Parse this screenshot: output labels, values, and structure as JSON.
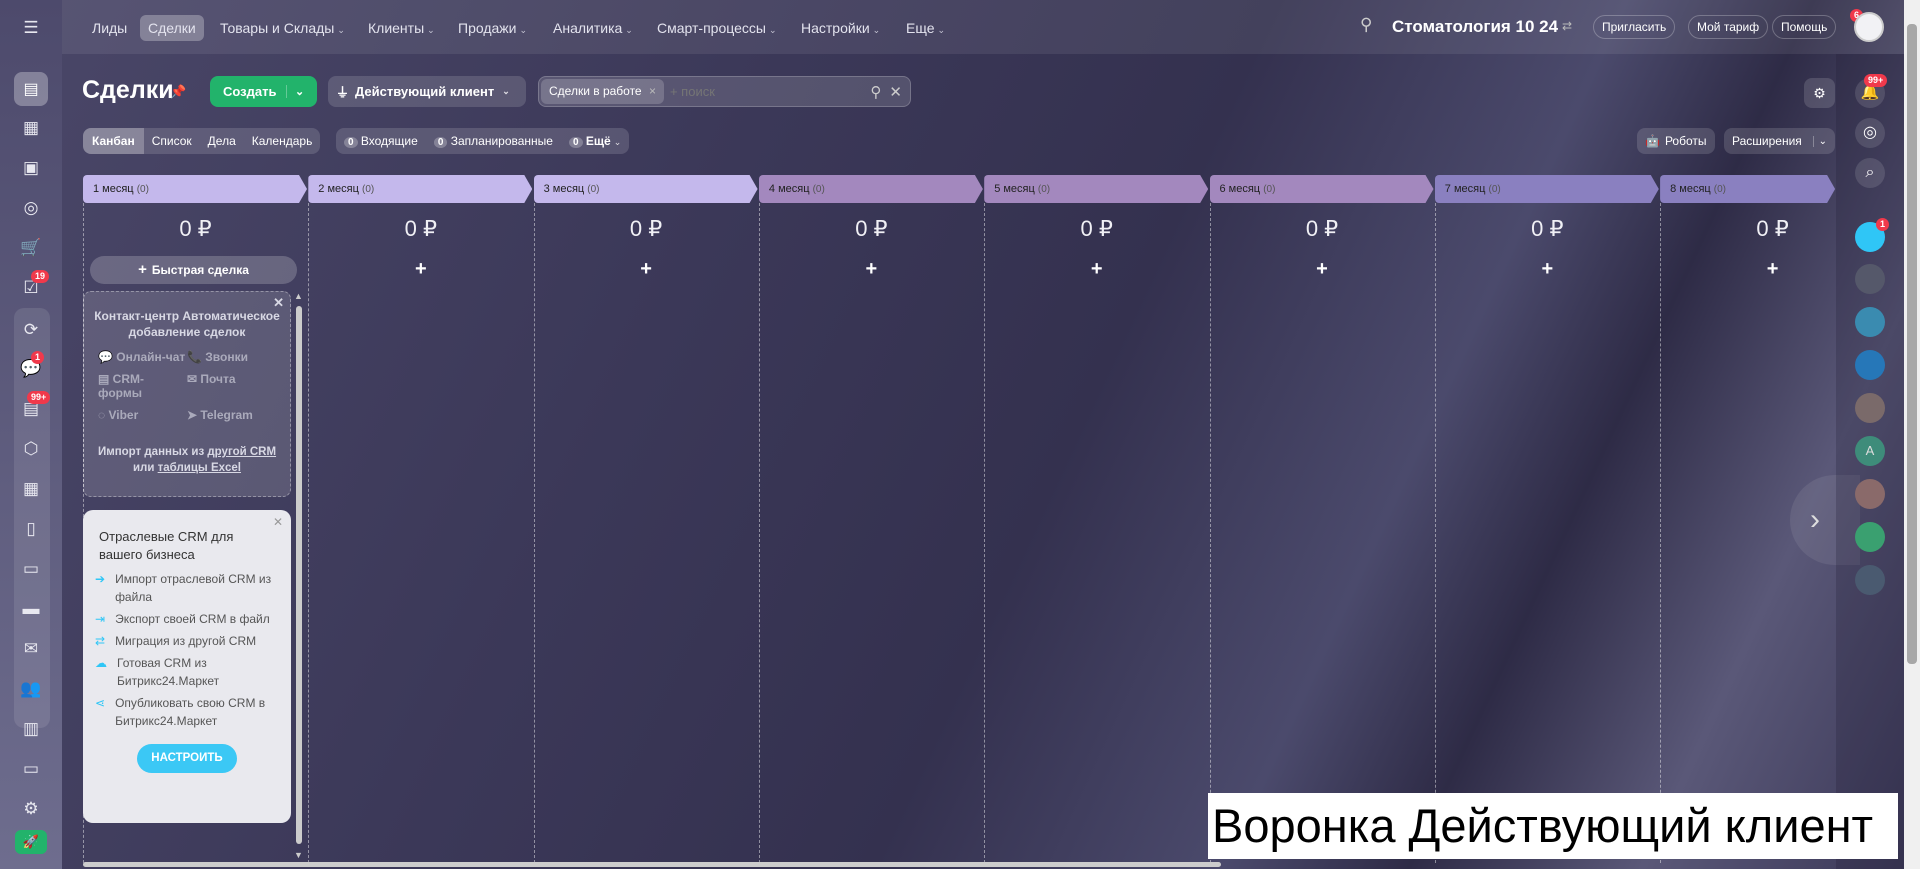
{
  "topnav": {
    "items": [
      {
        "label": "Лиды"
      },
      {
        "label": "Сделки",
        "active": true
      },
      {
        "label": "Товары и Склады",
        "dropdown": true
      },
      {
        "label": "Клиенты",
        "dropdown": true
      },
      {
        "label": "Продажи",
        "dropdown": true
      },
      {
        "label": "Аналитика",
        "dropdown": true
      },
      {
        "label": "Смарт-процессы",
        "dropdown": true
      },
      {
        "label": "Настройки",
        "dropdown": true
      },
      {
        "label": "Еще",
        "dropdown": true
      }
    ],
    "company": "Стоматология 10 24",
    "invite": "Пригласить",
    "tariff": "Мой тариф",
    "help": "Помощь",
    "help_badge": "6"
  },
  "leftbar": {
    "badges": {
      "tasks": "19",
      "chats": "1",
      "feed": "99+"
    }
  },
  "header": {
    "title": "Сделки",
    "create": "Создать",
    "funnel": "Действующий клиент",
    "filter_tag": "Сделки в работе",
    "search_placeholder": "+ поиск"
  },
  "views": [
    "Канбан",
    "Список",
    "Дела",
    "Календарь"
  ],
  "counters": [
    {
      "count": "0",
      "label": "Входящие"
    },
    {
      "count": "0",
      "label": "Запланированные"
    },
    {
      "count": "0",
      "label": "Ещё"
    }
  ],
  "robots": "Роботы",
  "extensions": "Расширения",
  "notifications_badge": "99+",
  "columns": [
    {
      "name": "1 месяц",
      "count": "(0)",
      "sum": "0 ₽",
      "color": "#c4b8ec"
    },
    {
      "name": "2 месяц",
      "count": "(0)",
      "sum": "0 ₽",
      "color": "#c4b8ec"
    },
    {
      "name": "3 месяц",
      "count": "(0)",
      "sum": "0 ₽",
      "color": "#c4b8ec"
    },
    {
      "name": "4 месяц",
      "count": "(0)",
      "sum": "0 ₽",
      "color": "#a388be"
    },
    {
      "name": "5 месяц",
      "count": "(0)",
      "sum": "0 ₽",
      "color": "#a388be"
    },
    {
      "name": "6 месяц",
      "count": "(0)",
      "sum": "0 ₽",
      "color": "#a388be"
    },
    {
      "name": "7 месяц",
      "count": "(0)",
      "sum": "0 ₽",
      "color": "#8a80c0"
    },
    {
      "name": "8 месяц",
      "count": "(0)",
      "sum": "0 ₽",
      "color": "#8a80c0"
    }
  ],
  "quick_deal": "Быстрая сделка",
  "contact_center": {
    "title": "Контакт-центр Автоматическое добавление сделок",
    "channels": [
      "Онлайн-чат",
      "Звонки",
      "CRM-формы",
      "Почта",
      "Viber",
      "Telegram"
    ],
    "import_text": "Импорт данных из",
    "import_link1": "другой CRM",
    "or": "или",
    "import_link2": "таблицы Excel"
  },
  "industry": {
    "title": "Отраслевые CRM для вашего бизнеса",
    "items": [
      "Импорт отраслевой CRM из файла",
      "Экспорт своей CRM в файл",
      "Миграция из другой CRM",
      "Готовая CRM из Битрикс24.Маркет",
      "Опубликовать свою CRM в Битрикс24.Маркет"
    ],
    "button": "НАСТРОИТЬ"
  },
  "right_badge": "1",
  "caption": "Воронка Действующий клиент"
}
